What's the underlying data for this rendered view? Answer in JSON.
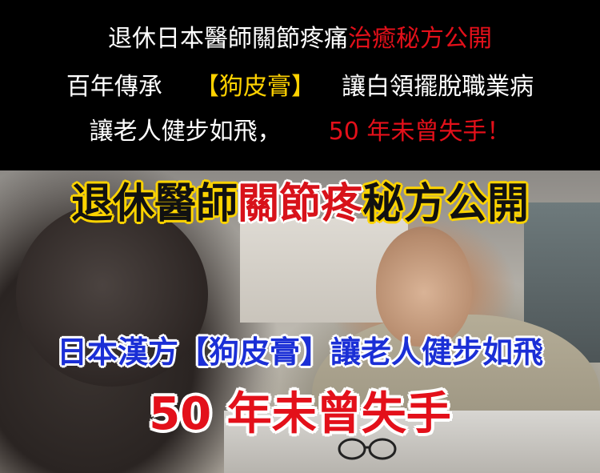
{
  "header": {
    "line1": {
      "white": "退休日本醫師關節疼痛",
      "red": "治癒秘方公開"
    },
    "line2": {
      "a": "百年傳承",
      "b": "【狗皮膏】",
      "c": "讓白領擺脫職業病"
    },
    "line3": {
      "a": "讓老人健步如飛，",
      "b": "50 年未曾失手！"
    }
  },
  "photo": {
    "title": {
      "black1": "退休醫師",
      "red": "關節疼",
      "black2": "秘方公開"
    },
    "subtitle": "日本漢方【狗皮膏】讓老人健步如飛",
    "slogan": "50 年未曾失手"
  },
  "colors": {
    "red": "#e3101a",
    "yellow": "#ffd200",
    "blue": "#1b2fd6"
  }
}
